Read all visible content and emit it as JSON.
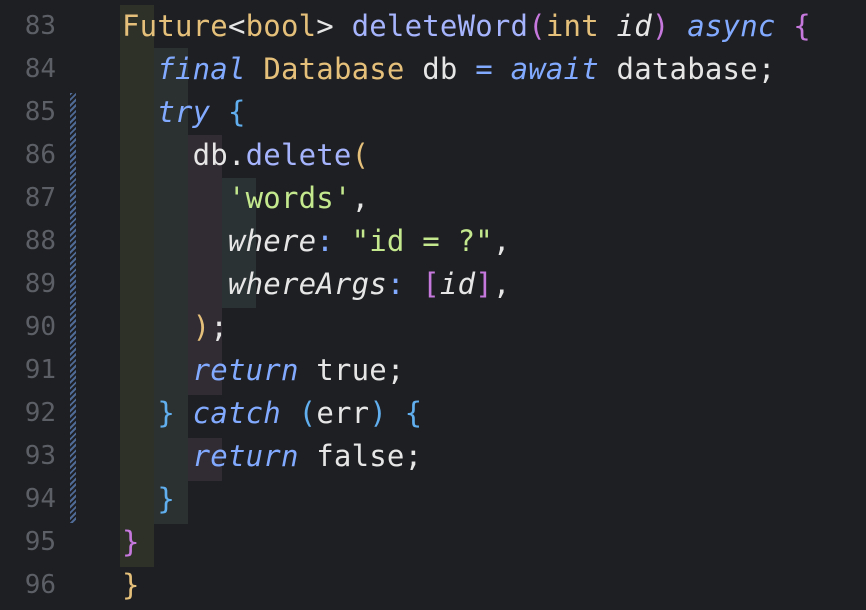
{
  "colors": {
    "background": "#1e1f22",
    "line_number": "#5c5f66",
    "default": "#e6e6e6",
    "type": "#e5c07b",
    "function": "#a5b4fc",
    "keyword_italic": "#82aaff",
    "string": "#c3e88d",
    "bracket_purple": "#c678dd",
    "bracket_blue": "#61afef",
    "bracket_yellow": "#e5c07b"
  },
  "lines": [
    {
      "number": "83",
      "tokens": [
        {
          "t": "Future",
          "c": "#e5c07b"
        },
        {
          "t": "<",
          "c": "#e6e6e6"
        },
        {
          "t": "bool",
          "c": "#e5c07b"
        },
        {
          "t": "> ",
          "c": "#e6e6e6"
        },
        {
          "t": "deleteWord",
          "c": "#a5b4fc"
        },
        {
          "t": "(",
          "c": "#c678dd"
        },
        {
          "t": "int",
          "c": "#e5c07b"
        },
        {
          "t": " ",
          "c": "#e6e6e6"
        },
        {
          "t": "id",
          "c": "#e6e6e6",
          "i": true
        },
        {
          "t": ")",
          "c": "#c678dd"
        },
        {
          "t": " ",
          "c": "#e6e6e6"
        },
        {
          "t": "async",
          "c": "#82aaff",
          "i": true
        },
        {
          "t": " ",
          "c": "#e6e6e6"
        },
        {
          "t": "{",
          "c": "#c678dd"
        }
      ]
    },
    {
      "number": "84",
      "tokens": [
        {
          "t": "  ",
          "c": "#e6e6e6"
        },
        {
          "t": "final",
          "c": "#82aaff",
          "i": true
        },
        {
          "t": " ",
          "c": "#e6e6e6"
        },
        {
          "t": "Database",
          "c": "#e5c07b"
        },
        {
          "t": " db ",
          "c": "#e6e6e6"
        },
        {
          "t": "=",
          "c": "#82aaff"
        },
        {
          "t": " ",
          "c": "#e6e6e6"
        },
        {
          "t": "await",
          "c": "#82aaff",
          "i": true
        },
        {
          "t": " database;",
          "c": "#e6e6e6"
        }
      ]
    },
    {
      "number": "85",
      "tokens": [
        {
          "t": "  ",
          "c": "#e6e6e6"
        },
        {
          "t": "try",
          "c": "#82aaff",
          "i": true
        },
        {
          "t": " ",
          "c": "#e6e6e6"
        },
        {
          "t": "{",
          "c": "#61afef"
        }
      ]
    },
    {
      "number": "86",
      "tokens": [
        {
          "t": "    db.",
          "c": "#e6e6e6"
        },
        {
          "t": "delete",
          "c": "#a5b4fc"
        },
        {
          "t": "(",
          "c": "#e5c07b"
        }
      ]
    },
    {
      "number": "87",
      "tokens": [
        {
          "t": "      ",
          "c": "#e6e6e6"
        },
        {
          "t": "'words'",
          "c": "#c3e88d"
        },
        {
          "t": ",",
          "c": "#e6e6e6"
        }
      ]
    },
    {
      "number": "88",
      "tokens": [
        {
          "t": "      ",
          "c": "#e6e6e6"
        },
        {
          "t": "where",
          "c": "#e6e6e6",
          "i": true
        },
        {
          "t": ": ",
          "c": "#82aaff"
        },
        {
          "t": "\"id = ?\"",
          "c": "#c3e88d"
        },
        {
          "t": ",",
          "c": "#e6e6e6"
        }
      ]
    },
    {
      "number": "89",
      "tokens": [
        {
          "t": "      ",
          "c": "#e6e6e6"
        },
        {
          "t": "whereArgs",
          "c": "#e6e6e6",
          "i": true
        },
        {
          "t": ": ",
          "c": "#82aaff"
        },
        {
          "t": "[",
          "c": "#c678dd"
        },
        {
          "t": "id",
          "c": "#e6e6e6",
          "i": true
        },
        {
          "t": "]",
          "c": "#c678dd"
        },
        {
          "t": ",",
          "c": "#e6e6e6"
        }
      ]
    },
    {
      "number": "90",
      "tokens": [
        {
          "t": "    ",
          "c": "#e6e6e6"
        },
        {
          "t": ")",
          "c": "#e5c07b"
        },
        {
          "t": ";",
          "c": "#e6e6e6"
        }
      ]
    },
    {
      "number": "91",
      "tokens": [
        {
          "t": "    ",
          "c": "#e6e6e6"
        },
        {
          "t": "return",
          "c": "#82aaff",
          "i": true
        },
        {
          "t": " true;",
          "c": "#e6e6e6"
        }
      ]
    },
    {
      "number": "92",
      "tokens": [
        {
          "t": "  ",
          "c": "#e6e6e6"
        },
        {
          "t": "}",
          "c": "#61afef"
        },
        {
          "t": " ",
          "c": "#e6e6e6"
        },
        {
          "t": "catch",
          "c": "#82aaff",
          "i": true
        },
        {
          "t": " ",
          "c": "#e6e6e6"
        },
        {
          "t": "(",
          "c": "#61afef"
        },
        {
          "t": "err",
          "c": "#e6e6e6"
        },
        {
          "t": ")",
          "c": "#61afef"
        },
        {
          "t": " ",
          "c": "#e6e6e6"
        },
        {
          "t": "{",
          "c": "#61afef"
        }
      ]
    },
    {
      "number": "93",
      "tokens": [
        {
          "t": "    ",
          "c": "#e6e6e6"
        },
        {
          "t": "return",
          "c": "#82aaff",
          "i": true
        },
        {
          "t": " false;",
          "c": "#e6e6e6"
        }
      ]
    },
    {
      "number": "94",
      "tokens": [
        {
          "t": "  ",
          "c": "#e6e6e6"
        },
        {
          "t": "}",
          "c": "#61afef"
        }
      ]
    },
    {
      "number": "95",
      "tokens": [
        {
          "t": "}",
          "c": "#c678dd"
        }
      ]
    },
    {
      "number": "96",
      "tokens": [
        {
          "t": "}",
          "c": "#e5c07b"
        }
      ]
    }
  ]
}
